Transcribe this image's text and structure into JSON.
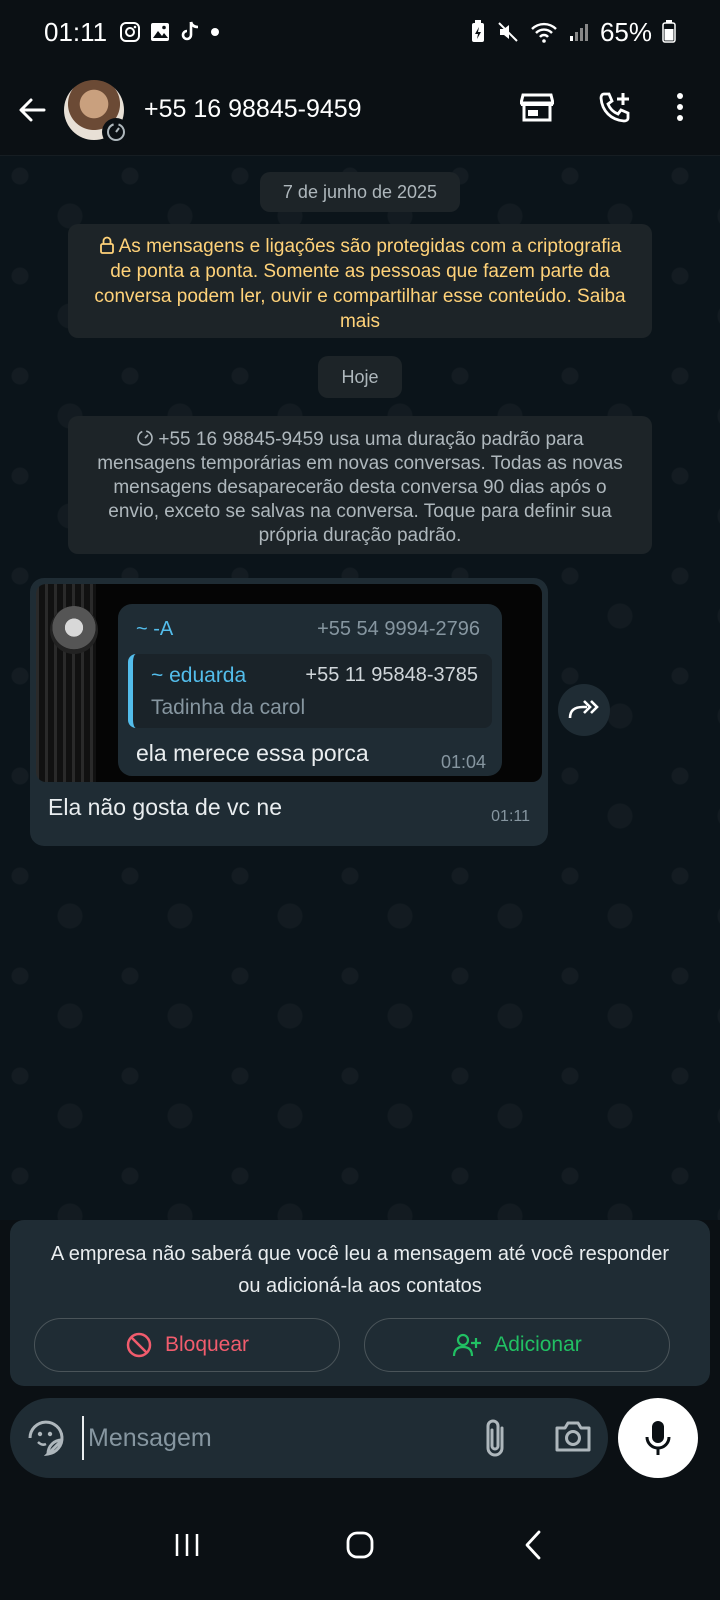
{
  "status_bar": {
    "time": "01:11",
    "battery": "65%",
    "left_icons": [
      "instagram-icon",
      "gallery-icon",
      "tiktok-icon",
      "dot-icon"
    ],
    "right_icons": [
      "battery-saver-icon",
      "mute-icon",
      "wifi-icon",
      "signal-icon",
      "battery-icon"
    ]
  },
  "header": {
    "contact": "+55 16 98845-9459",
    "actions": [
      "store-icon",
      "add-call-icon",
      "more-icon"
    ]
  },
  "chat": {
    "date_chip": "7 de junho de 2025",
    "encryption_notice": "As mensagens e ligações são protegidas com a criptografia de ponta a ponta. Somente as pessoas que fazem parte da conversa podem ler, ouvir e compartilhar esse conteúdo. Saiba mais",
    "today_chip": "Hoje",
    "temp_notice": "+55 16 98845-9459 usa uma duração padrão para mensagens temporárias em novas conversas. Todas as novas mensagens desaparecerão desta conversa 90 dias após o envio, exceto se salvas na conversa. Toque para definir sua própria duração padrão.",
    "message": {
      "quote_sender": "~ -A",
      "quote_sender_phone": "+55 54 9994-2796",
      "inner_quote_name": "~ eduarda",
      "inner_quote_phone": "+55 11 95848-3785",
      "inner_quote_text": "Tadinha da carol",
      "quote_body": "ela merece essa porca",
      "quote_time": "01:04",
      "text": "Ela não gosta de vc ne",
      "time": "01:11"
    }
  },
  "business_panel": {
    "notice": "A empresa não saberá que você leu a mensagem até você responder ou adicioná-la aos contatos",
    "block_label": "Bloquear",
    "add_label": "Adicionar"
  },
  "composer": {
    "placeholder": "Mensagem"
  },
  "colors": {
    "accent_green": "#21c063",
    "danger_red": "#f15c6d",
    "link_blue": "#53bdeb",
    "notice_yellow": "#ffd279"
  }
}
